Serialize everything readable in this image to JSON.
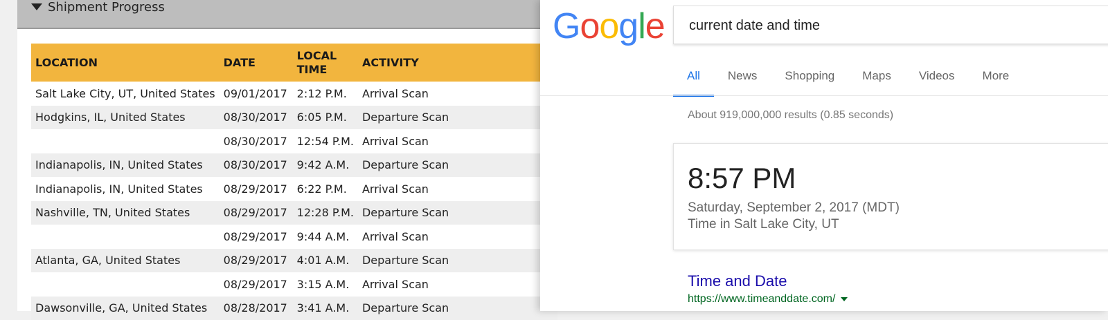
{
  "shipment": {
    "section_title": "Shipment Progress",
    "columns": [
      "LOCATION",
      "DATE",
      "LOCAL TIME",
      "ACTIVITY"
    ],
    "rows": [
      {
        "location": "Salt Lake City, UT, United States",
        "date": "09/01/2017",
        "time": "2:12 P.M.",
        "activity": "Arrival Scan"
      },
      {
        "location": "Hodgkins, IL, United States",
        "date": "08/30/2017",
        "time": "6:05 P.M.",
        "activity": "Departure Scan"
      },
      {
        "location": "",
        "date": "08/30/2017",
        "time": "12:54 P.M.",
        "activity": "Arrival Scan"
      },
      {
        "location": "Indianapolis, IN, United States",
        "date": "08/30/2017",
        "time": "9:42 A.M.",
        "activity": "Departure Scan"
      },
      {
        "location": "Indianapolis, IN, United States",
        "date": "08/29/2017",
        "time": "6:22 P.M.",
        "activity": "Arrival Scan"
      },
      {
        "location": "Nashville, TN, United States",
        "date": "08/29/2017",
        "time": "12:28 P.M.",
        "activity": "Departure Scan"
      },
      {
        "location": "",
        "date": "08/29/2017",
        "time": "9:44 A.M.",
        "activity": "Arrival Scan"
      },
      {
        "location": "Atlanta, GA, United States",
        "date": "08/29/2017",
        "time": "4:01 A.M.",
        "activity": "Departure Scan"
      },
      {
        "location": "",
        "date": "08/29/2017",
        "time": "3:15 A.M.",
        "activity": "Arrival Scan"
      },
      {
        "location": "Dawsonville, GA, United States",
        "date": "08/28/2017",
        "time": "3:41 A.M.",
        "activity": "Departure Scan"
      }
    ],
    "header_color": "#f2b53e"
  },
  "google": {
    "logo_letters": [
      {
        "ch": "G",
        "color": "#4285F4"
      },
      {
        "ch": "o",
        "color": "#EA4335"
      },
      {
        "ch": "o",
        "color": "#FBBC05"
      },
      {
        "ch": "g",
        "color": "#4285F4"
      },
      {
        "ch": "l",
        "color": "#34A853"
      },
      {
        "ch": "e",
        "color": "#EA4335"
      }
    ],
    "query": "current date and time",
    "tabs": [
      "All",
      "News",
      "Shopping",
      "Maps",
      "Videos",
      "More"
    ],
    "active_tab": "All",
    "result_stats": "About 919,000,000 results (0.85 seconds)",
    "time_card": {
      "time": "8:57 PM",
      "date": "Saturday, September 2, 2017 (MDT)",
      "place": "Time in Salt Lake City, UT"
    },
    "result": {
      "title": "Time and Date",
      "url": "https://www.timeanddate.com/"
    },
    "accent_color": "#1a73e8"
  }
}
